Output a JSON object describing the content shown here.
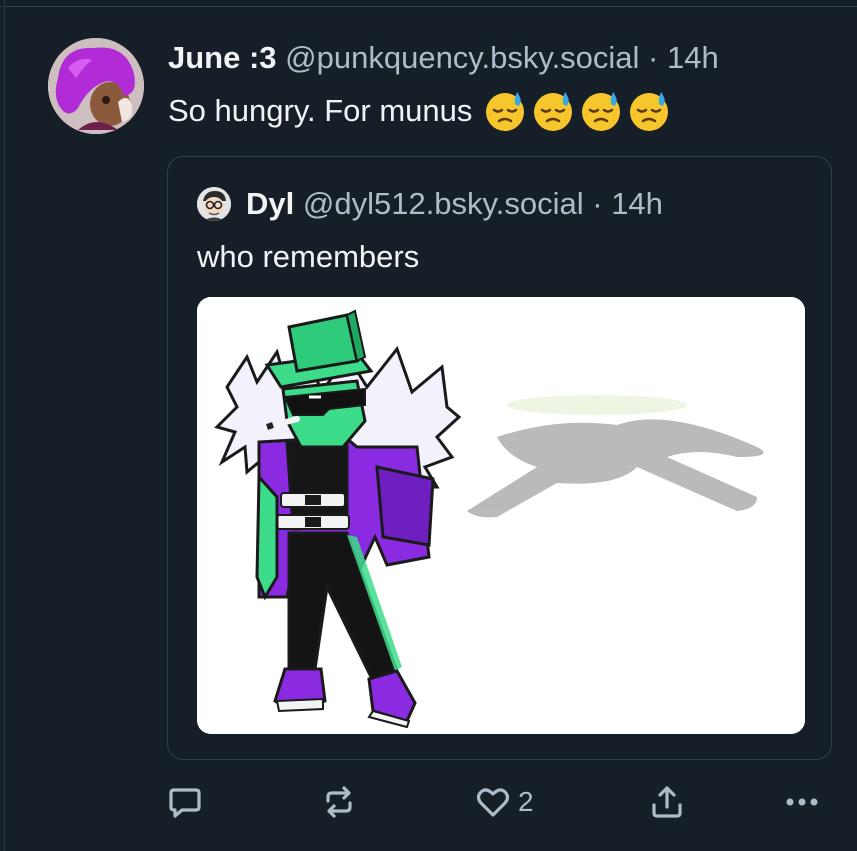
{
  "post": {
    "author_name": "June :3",
    "handle": "@punkquency.bsky.social",
    "separator": " · ",
    "time": "14h",
    "text": "So hungry. For munus",
    "emoji": [
      "downcast-face-with-sweat",
      "downcast-face-with-sweat",
      "downcast-face-with-sweat",
      "downcast-face-with-sweat"
    ]
  },
  "quote": {
    "author_name": "Dyl",
    "handle": "@dyl512.bsky.social",
    "separator": " · ",
    "time": "14h",
    "text": "who remembers",
    "image_subject": "cartoon character in green top hat, sunglasses and purple fur-collared jacket"
  },
  "actions": {
    "reply_icon": "comment-icon",
    "repost_icon": "repost-icon",
    "like_icon": "heart-icon",
    "like_count": "2",
    "share_icon": "share-icon",
    "more_icon": "more-dots-icon"
  },
  "colors": {
    "background": "#161e27",
    "text": "#f1f3f5",
    "muted": "#aebbc9",
    "border": "#2e4052",
    "emoji_yellow": "#f7c52c",
    "emoji_sweat": "#3aa6e8",
    "character_green": "#3ddc8a",
    "character_purple": "#8a2be2"
  }
}
